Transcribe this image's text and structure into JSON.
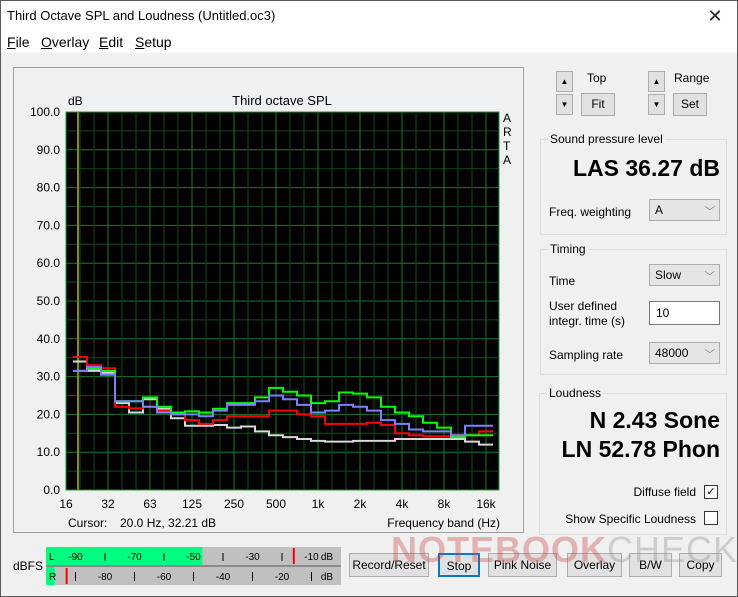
{
  "window": {
    "title": "Third Octave SPL and Loudness (Untitled.oc3)",
    "close_icon": "close-icon"
  },
  "menu": [
    "File",
    "Overlay",
    "Edit",
    "Setup"
  ],
  "chart": {
    "cursor_label": "Cursor:",
    "cursor_value": "20.0 Hz, 32.21 dB",
    "side_label": [
      "A",
      "R",
      "T",
      "A"
    ]
  },
  "chart_data": {
    "type": "line",
    "title": "Third octave SPL",
    "ylabel": "dB",
    "xlabel": "Frequency band (Hz)",
    "ylim": [
      0,
      100
    ],
    "yticks": [
      "0.0",
      "10.0",
      "20.0",
      "30.0",
      "40.0",
      "50.0",
      "60.0",
      "70.0",
      "80.0",
      "90.0",
      "100.0"
    ],
    "xticks": [
      "16",
      "32",
      "63",
      "125",
      "250",
      "500",
      "1k",
      "2k",
      "4k",
      "8k",
      "16k"
    ],
    "grid": true,
    "cursor_hz": 20.0,
    "bands": [
      "20",
      "25",
      "31.5",
      "40",
      "50",
      "63",
      "80",
      "100",
      "125",
      "160",
      "200",
      "250",
      "315",
      "400",
      "500",
      "630",
      "800",
      "1k",
      "1.25k",
      "1.6k",
      "2k",
      "2.5k",
      "3.15k",
      "4k",
      "5k",
      "6.3k",
      "8k",
      "10k",
      "12.5k",
      "16k"
    ],
    "series": [
      {
        "name": "white",
        "color": "#d8d8d8",
        "values": [
          34.0,
          31.5,
          31.0,
          23.0,
          20.5,
          24.0,
          21.5,
          19.0,
          17.0,
          17.0,
          17.2,
          16.5,
          16.8,
          15.5,
          14.5,
          14.0,
          13.5,
          13.0,
          12.8,
          12.8,
          13.0,
          13.0,
          13.0,
          13.5,
          13.5,
          13.5,
          13.5,
          13.5,
          12.8,
          12.0
        ]
      },
      {
        "name": "red",
        "color": "#ff0000",
        "values": [
          35.2,
          33.0,
          32.2,
          22.0,
          21.6,
          22.0,
          21.0,
          20.0,
          18.5,
          17.5,
          18.5,
          19.5,
          19.5,
          19.5,
          21.0,
          21.0,
          20.0,
          19.5,
          17.5,
          17.5,
          17.5,
          17.8,
          17.2,
          15.0,
          14.5,
          14.2,
          14.2,
          14.5,
          14.5,
          15.5
        ]
      },
      {
        "name": "green",
        "color": "#00ff00",
        "values": [
          31.5,
          32.0,
          31.5,
          23.5,
          23.5,
          24.5,
          22.0,
          20.5,
          20.8,
          20.5,
          21.5,
          23.0,
          23.0,
          24.5,
          27.0,
          26.0,
          25.0,
          23.0,
          23.5,
          25.8,
          25.5,
          24.5,
          22.0,
          20.5,
          19.5,
          17.8,
          16.5,
          14.0,
          14.5,
          14.5
        ]
      },
      {
        "name": "blue",
        "color": "#8080ff",
        "values": [
          31.5,
          32.5,
          30.5,
          23.5,
          23.5,
          22.0,
          20.5,
          20.0,
          20.0,
          19.5,
          21.0,
          22.5,
          22.5,
          23.5,
          25.0,
          24.0,
          22.5,
          20.5,
          21.0,
          22.5,
          22.0,
          21.0,
          18.5,
          17.5,
          16.0,
          15.5,
          15.5,
          14.5,
          17.0,
          17.0
        ]
      }
    ]
  },
  "controls": {
    "top_label": "Top",
    "fit_label": "Fit",
    "range_label": "Range",
    "set_label": "Set"
  },
  "spl": {
    "group_title": "Sound pressure level",
    "value": "LAS 36.27 dB",
    "weighting_label": "Freq. weighting",
    "weighting_value": "A"
  },
  "timing": {
    "group_title": "Timing",
    "time_label": "Time",
    "time_value": "Slow",
    "integr_label_1": "User defined",
    "integr_label_2": "integr. time (s)",
    "integr_value": "10",
    "sampling_label": "Sampling rate",
    "sampling_value": "48000"
  },
  "loudness": {
    "group_title": "Loudness",
    "n_value": "N 2.43 Sone",
    "ln_value": "LN 52.78 Phon",
    "diffuse_label": "Diffuse field",
    "diffuse_checked": true,
    "specific_label": "Show Specific Loudness",
    "specific_checked": false
  },
  "meter": {
    "label": "dBFS",
    "left_channel": "L",
    "right_channel": "R",
    "left_scale": [
      "-90",
      "-70",
      "-50",
      "-30",
      "-10",
      "dB"
    ],
    "right_scale": [
      "-80",
      "-60",
      "-40",
      "-20",
      "dB"
    ],
    "left_level_dbfs": -47,
    "right_level_dbfs": -97,
    "left_peak_dbfs": -16,
    "right_peak_dbfs": -93,
    "fill_color": "#00ff80",
    "peak_color": "#ff0000"
  },
  "buttons": {
    "record": "Record/Reset",
    "stop": "Stop",
    "pink_noise": "Pink Noise",
    "overlay": "Overlay",
    "bw": "B/W",
    "copy": "Copy"
  },
  "watermark": {
    "bold": "NOTEBOOK",
    "light": "CHECK"
  }
}
